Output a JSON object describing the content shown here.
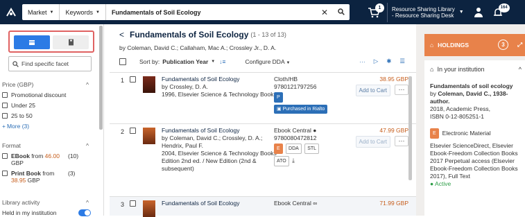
{
  "topbar": {
    "scope_label": "Market",
    "field_label": "Keywords",
    "query": "Fundamentals of Soil Ecology",
    "clear_icon": "close-icon",
    "search_icon": "search-icon",
    "cart_badge": "1",
    "library_line1": "Resource Sharing Library",
    "library_line2": "- Resource Sharing Desk",
    "notif_badge": "164"
  },
  "facets": {
    "search_placeholder": "Find specific facet",
    "price": {
      "heading": "Price (GBP)",
      "options": [
        "Promotional discount",
        "Under 25",
        "25 to 50"
      ],
      "more": "More (3)"
    },
    "format": {
      "heading": "Format",
      "ebook_label": "EBook",
      "ebook_from": "from",
      "ebook_price": "46.00",
      "ebook_count": "(10)",
      "ebook_currency": "GBP",
      "print_label": "Print Book",
      "print_from": "from",
      "print_price": "38.95",
      "print_count": "(3)",
      "print_currency": "GBP"
    },
    "library": {
      "heading": "Library activity",
      "held_label": "Held in my institution"
    }
  },
  "main": {
    "title": "Fundamentals of Soil Ecology",
    "count": "(1 - 13 of 13)",
    "authors_prefix": "by",
    "authors": "Coleman, David C.; Callaham, Mac A.; Crossley Jr., D. A.",
    "sort_label": "Sort by:",
    "sort_value": "Publication Year",
    "configure": "Configure DDA",
    "results": [
      {
        "num": "1",
        "title": "Fundamentals of Soil Ecology",
        "by": "by",
        "author": "Crossley, D. A.",
        "pub": "1996, Elsevier Science & Technology Books",
        "format": "Cloth/HB",
        "isbn": "9780121797256",
        "price": "38.95 GBP",
        "tag": "P",
        "purchased": "Purchased in Rialto",
        "addcart": "Add to Cart"
      },
      {
        "num": "2",
        "title": "Fundamentals of Soil Ecology",
        "by": "by",
        "author": "Coleman, David C.; Crossley, D. A.; Hendrix, Paul F.",
        "pub": "2004, Elsevier Science & Technology Books",
        "edition": "Edition 2nd ed. / New Edition (2nd & subsequent)",
        "format": "Ebook Central",
        "isbn": "9780080472812",
        "price": "47.99 GBP",
        "tags": [
          "E",
          "DDA",
          "STL",
          "ATO"
        ],
        "addcart": "Add to Cart"
      },
      {
        "num": "3",
        "title": "Fundamentals of Soil Ecology",
        "format": "Ebook Central ∞",
        "price": "71.99 GBP"
      }
    ]
  },
  "holdings": {
    "heading": "HOLDINGS",
    "count": "3",
    "section": "In your institution",
    "title": "Fundamentals of soil ecology",
    "by": "by",
    "author": "Coleman, David C., 1938-",
    "author_tail": "author.",
    "pub": "2018, Academic Press,",
    "isbn": "ISBN 0-12-805251-1",
    "material_tag": "E",
    "material": "Electronic Material",
    "desc": "Elsevier ScienceDirect, Elsevier Ebook-Freedom Collection Books 2017 Perpetual access (Elsevier Ebook-Freedom Collection Books 2017), Full Text",
    "status": "Active"
  },
  "colors": {
    "topbar": "#0c2340",
    "price": "#c65c1a",
    "holdings_header": "#e8824a",
    "active": "#2e9e48",
    "toggle": "#2c7be5"
  }
}
